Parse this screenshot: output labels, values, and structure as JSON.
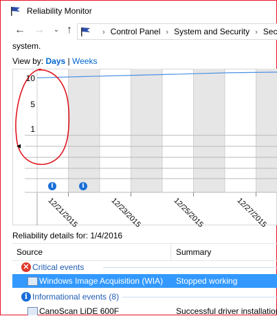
{
  "window": {
    "title": "Reliability Monitor"
  },
  "navigation": {
    "back_icon": "back-arrow-icon",
    "forward_icon": "forward-arrow-icon",
    "recent_icon": "chevron-down-icon",
    "up_icon": "up-arrow-icon",
    "breadcrumbs": [
      "Control Panel",
      "System and Security",
      "Secu"
    ]
  },
  "intro_text": "system.",
  "view_by": {
    "label": "View by:",
    "days": "Days",
    "separator": "|",
    "weeks": "Weeks",
    "selected": "Days"
  },
  "chart_data": {
    "type": "line",
    "title": "",
    "y_ticks": [
      "10",
      "5",
      "1"
    ],
    "ylim": [
      0,
      10
    ],
    "x_tick_labels": [
      "12/21/2015",
      "12/23/2015",
      "12/25/2015",
      "12/27/2015"
    ],
    "series": [
      {
        "values": [
          9.1,
          9.3,
          9.5,
          9.7,
          9.9,
          10
        ]
      }
    ],
    "info_event_days": [
      "12/20/2015",
      "12/21/2015"
    ],
    "colors": {
      "line": "#4a90e2",
      "shaded": "#e6e6e6",
      "info": "#1a6ed8"
    }
  },
  "details": {
    "label": "Reliability details for: 1/4/2016",
    "columns": [
      "Source",
      "Summary"
    ],
    "groups": [
      {
        "title": "Critical events",
        "icon": "error-x-icon",
        "icon_glyph": "✕",
        "color": "#e0392b",
        "rows": [
          {
            "source": "Windows Image Acquisition (WIA)",
            "summary": "Stopped working",
            "selected": true
          }
        ]
      },
      {
        "title": "Informational events (8)",
        "icon": "info-icon",
        "icon_glyph": "i",
        "color": "#1a6ed8",
        "rows": [
          {
            "source": "CanoScan LiDE 600F",
            "summary": "Successful driver installation",
            "selected": false
          }
        ]
      }
    ]
  },
  "scroll_left_glyph": "◀",
  "info_badge_glyph": "i"
}
